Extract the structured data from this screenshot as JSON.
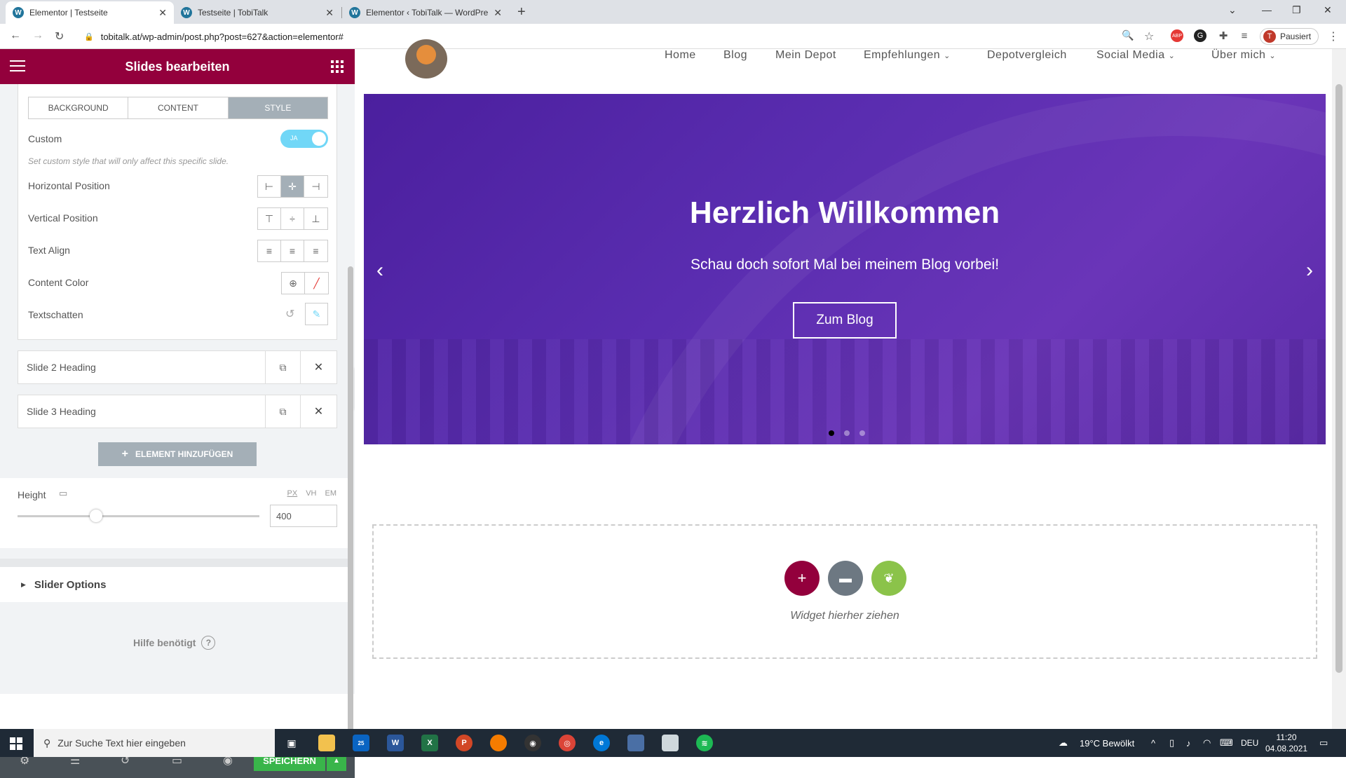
{
  "browser": {
    "tabs": [
      {
        "label": "Elementor | Testseite",
        "active": true
      },
      {
        "label": "Testseite | TobiTalk",
        "active": false
      },
      {
        "label": "Elementor ‹ TobiTalk — WordPre",
        "active": false
      }
    ],
    "url": "tobitalk.at/wp-admin/post.php?post=627&action=elementor#",
    "profile_label": "Pausiert",
    "profile_initial": "T"
  },
  "panel": {
    "title": "Slides bearbeiten",
    "tabs": [
      "BACKGROUND",
      "CONTENT",
      "STYLE"
    ],
    "custom_label": "Custom",
    "toggle_text": "JA",
    "custom_hint": "Set custom style that will only affect this specific slide.",
    "controls": [
      {
        "label": "Horizontal Position"
      },
      {
        "label": "Vertical Position"
      },
      {
        "label": "Text Align"
      },
      {
        "label": "Content Color"
      },
      {
        "label": "Textschatten"
      }
    ],
    "repeater_items": [
      "Slide 2 Heading",
      "Slide 3 Heading"
    ],
    "add_element_label": "ELEMENT HINZUFÜGEN",
    "height_label": "Height",
    "units": [
      "PX",
      "VH",
      "EM"
    ],
    "height_value": "400",
    "slider_options_label": "Slider Options",
    "help_label": "Hilfe benötigt",
    "save_label": "SPEICHERN"
  },
  "site": {
    "nav": [
      "Home",
      "Blog",
      "Mein Depot",
      "Empfehlungen",
      "Depotvergleich",
      "Social Media",
      "Über mich"
    ],
    "hero_title": "Herzlich Willkommen",
    "hero_subtitle": "Schau doch sofort Mal bei meinem Blog vorbei!",
    "hero_button": "Zum Blog",
    "dropzone_text": "Widget hierher ziehen"
  },
  "taskbar": {
    "search_placeholder": "Zur Suche Text hier eingeben",
    "weather": "19°C  Bewölkt",
    "lang": "DEU",
    "time": "11:20",
    "date": "04.08.2021",
    "mail_badge": "25"
  },
  "colors": {
    "elementor_brand": "#93003c",
    "save_green": "#39b54a",
    "hero_purple": "#5a2db0"
  }
}
